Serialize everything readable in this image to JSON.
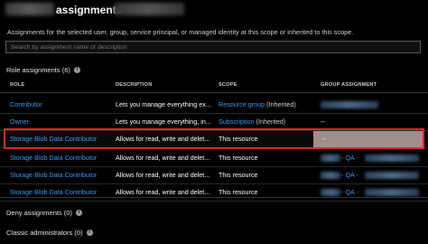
{
  "header": {
    "title": "assignments -"
  },
  "subtitle": "Assignments for the selected user, group, service principal, or managed identity at this scope or inherited to this scope.",
  "search": {
    "placeholder": "Search by assignment name or description"
  },
  "role_assignments": {
    "label": "Role assignments (6)",
    "columns": [
      "ROLE",
      "DESCRIPTION",
      "SCOPE",
      "GROUP ASSIGNMENT"
    ],
    "rows": [
      {
        "role": "Contributor",
        "description": "Lets you manage everything ex...",
        "scope_link": "Resource group",
        "scope_suffix": "(Inherited)",
        "group": ""
      },
      {
        "role": "Owner",
        "description": "Lets you manage everything, in...",
        "scope_link": "Subscription",
        "scope_suffix": "(Inherited)",
        "group": "--"
      },
      {
        "role": "Storage Blob Data Contributor",
        "description": "Allows for read, write and delet...",
        "scope_link": "",
        "scope_text": "This resource",
        "group": "--"
      },
      {
        "role": "Storage Blob Data Contributor",
        "description": "Allows for read, write and delet...",
        "scope_link": "",
        "scope_text": "This resource",
        "group": "- QA -"
      },
      {
        "role": "Storage Blob Data Contributor",
        "description": "Allows for read, write and delet...",
        "scope_link": "",
        "scope_text": "This resource",
        "group": "- QA -"
      },
      {
        "role": "Storage Blob Data Contributor",
        "description": "Allows for read, write and delet...",
        "scope_link": "",
        "scope_text": "This resource",
        "group": "- QA -"
      }
    ]
  },
  "deny_assignments": {
    "label": "Deny assignments (0)"
  },
  "classic_admins": {
    "label": "Classic administrators (0)"
  },
  "colors": {
    "link": "#3b9bf2",
    "highlight_border": "#e0262b",
    "background": "#000000"
  },
  "icons": [
    "info-icon"
  ]
}
